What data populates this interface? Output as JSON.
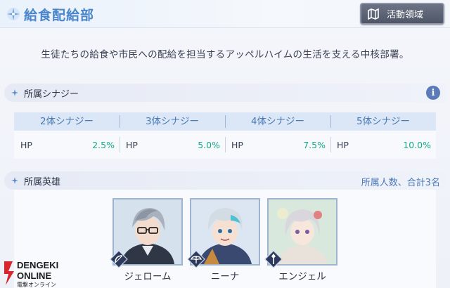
{
  "header": {
    "title": "給食配給部",
    "area_button": "活動領域"
  },
  "description": "生徒たちの給食や市民への配給を担当するアッペルハイムの生活を支える中核部署。",
  "synergy_section": {
    "title": "所属シナジー",
    "info_icon": "i",
    "headers": [
      "2体シナジー",
      "3体シナジー",
      "4体シナジー",
      "5体シナジー"
    ],
    "cells": [
      {
        "stat": "HP",
        "value": "2.5%"
      },
      {
        "stat": "HP",
        "value": "5.0%"
      },
      {
        "stat": "HP",
        "value": "7.5%"
      },
      {
        "stat": "HP",
        "value": "10.0%"
      }
    ]
  },
  "heroes_section": {
    "title": "所属英雄",
    "count_text": "所属人数、合計3名",
    "heroes": [
      {
        "name": "ジェローム",
        "class_icon": "bow-icon"
      },
      {
        "name": "ニーナ",
        "class_icon": "wings-icon"
      },
      {
        "name": "エンジェル",
        "class_icon": "staff-icon"
      }
    ]
  },
  "watermark": {
    "line1": "DENGEKI",
    "line2": "ONLINE",
    "line3": "電撃オンライン"
  },
  "colors": {
    "accent": "#4a86c9",
    "value_green": "#19a889",
    "header_row": "#dbe7f6"
  }
}
